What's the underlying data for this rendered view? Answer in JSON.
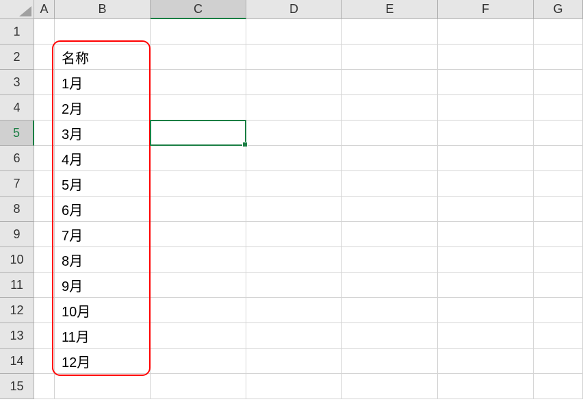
{
  "columns": [
    "A",
    "B",
    "C",
    "D",
    "E",
    "F",
    "G"
  ],
  "rows": [
    "1",
    "2",
    "3",
    "4",
    "5",
    "6",
    "7",
    "8",
    "9",
    "10",
    "11",
    "12",
    "13",
    "14",
    "15"
  ],
  "selectedCell": "C5",
  "selectedRow": "5",
  "selectedCol": "C",
  "cells": {
    "B2": "名称",
    "B3": "1月",
    "B4": "2月",
    "B5": "3月",
    "B6": "4月",
    "B7": "5月",
    "B8": "6月",
    "B9": "7月",
    "B10": "8月",
    "B11": "9月",
    "B12": "10月",
    "B13": "11月",
    "B14": "12月"
  },
  "annotation": {
    "range": "B2:B14",
    "color": "#ff0000"
  }
}
